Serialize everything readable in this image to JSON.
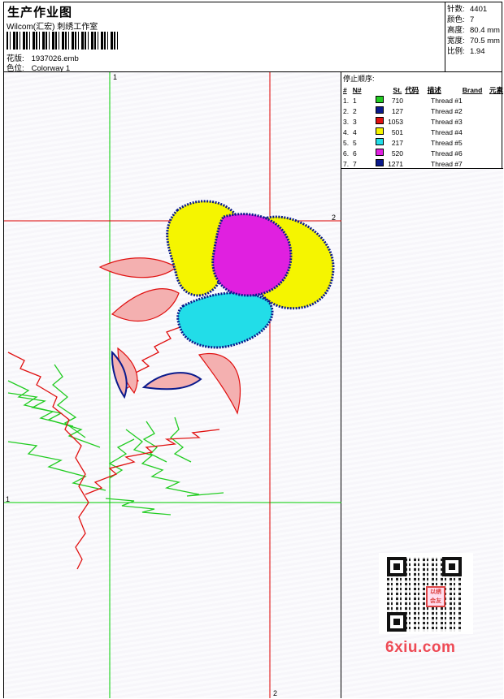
{
  "header": {
    "title": "生产作业图",
    "company": "Wilcom(汇宏) 刺绣工作室",
    "design_label": "花版:",
    "design_value": "1937026.emb",
    "colorway_label": "色位:",
    "colorway_value": "Colorway 1"
  },
  "stats": [
    {
      "label": "针数:",
      "value": "4401"
    },
    {
      "label": "颜色:",
      "value": "7"
    },
    {
      "label": "高度:",
      "value": "80.4 mm"
    },
    {
      "label": "宽度:",
      "value": "70.5 mm"
    },
    {
      "label": "比例:",
      "value": "1.94"
    }
  ],
  "stop_sequence": {
    "caption": "停止顺序:",
    "columns": [
      "#",
      "N#",
      "",
      "St.",
      "代码",
      "描述",
      "Brand",
      "元素"
    ],
    "rows": [
      {
        "num": "1.",
        "n": "1",
        "color": "#22cc22",
        "stitches": "710",
        "desc": "Thread #1"
      },
      {
        "num": "2.",
        "n": "2",
        "color": "#0a1a8c",
        "stitches": "127",
        "desc": "Thread #2"
      },
      {
        "num": "3.",
        "n": "3",
        "color": "#e01010",
        "stitches": "1053",
        "desc": "Thread #3"
      },
      {
        "num": "4.",
        "n": "4",
        "color": "#f5f500",
        "stitches": "501",
        "desc": "Thread #4"
      },
      {
        "num": "5.",
        "n": "5",
        "color": "#22dde8",
        "stitches": "217",
        "desc": "Thread #5"
      },
      {
        "num": "6.",
        "n": "6",
        "color": "#e020e0",
        "stitches": "520",
        "desc": "Thread #6"
      },
      {
        "num": "7.",
        "n": "7",
        "color": "#0a1a8c",
        "stitches": "1271",
        "desc": "Thread #7"
      }
    ]
  },
  "guides": {
    "green_v_label": "1",
    "green_h_label": "1",
    "red_h_label": "2",
    "red_v_label": "2"
  },
  "watermark": {
    "brand": "6xiu.com",
    "seal_text": "以绣会友"
  }
}
